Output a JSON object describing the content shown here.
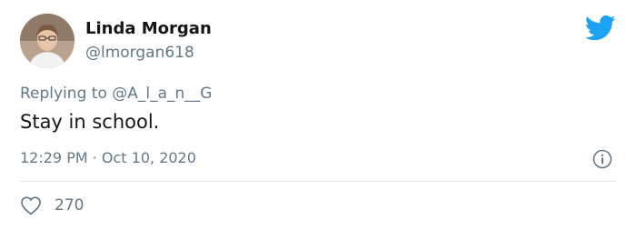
{
  "tweet": {
    "author_name": "Linda Morgan",
    "author_handle": "@lmorgan618",
    "replying_prefix": "Replying to",
    "replying_to": "@A_l_a_n__G",
    "text": "Stay in school.",
    "timestamp": "12:29 PM · Oct 10, 2020",
    "like_count": "270"
  },
  "icons": {
    "brand": "twitter-bird-icon",
    "info": "info-icon",
    "like": "heart-icon"
  },
  "colors": {
    "brand": "#1da1f2",
    "muted": "#657786",
    "text": "#14171a",
    "divider": "#e1e8ed"
  }
}
